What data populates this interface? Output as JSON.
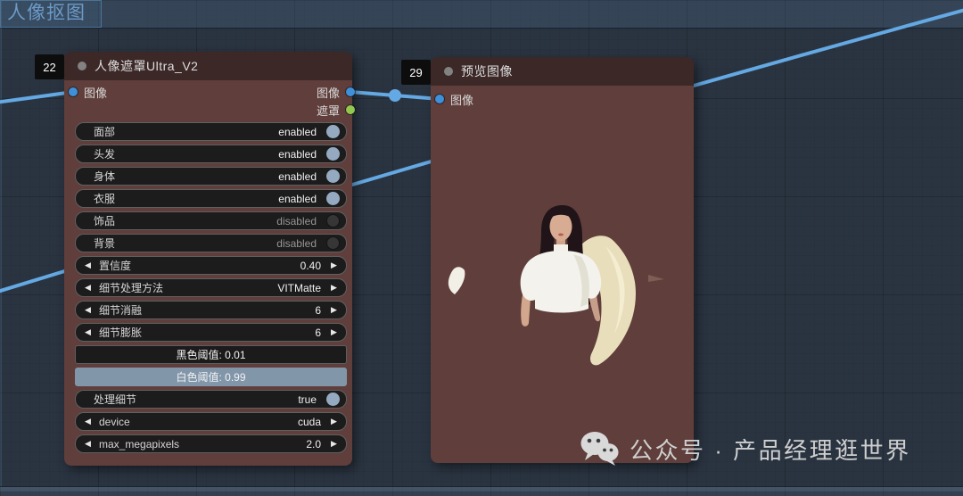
{
  "group": {
    "title": "人像抠图"
  },
  "colors": {
    "canvas_bg": "#2a3441",
    "node_body": "#5f3e3b",
    "node_header": "#3b2827",
    "widget_bg": "#1c1c1c",
    "widget_border": "#606060",
    "accent_fill": "#8296aa",
    "toggle_on": "#95aac1",
    "wire": "#64a9e3",
    "port_blue": "#3f90da",
    "port_green": "#93c84f",
    "badge_bg": "#0d0d0d",
    "group_title": "#6c9ac7",
    "watermark": "#cfcfcf"
  },
  "nodes": {
    "portrait_mask": {
      "id": "22",
      "title": "人像遮罩Ultra_V2",
      "inputs": [
        {
          "label": "图像",
          "color": "blue"
        }
      ],
      "outputs": [
        {
          "label": "图像",
          "color": "blue"
        },
        {
          "label": "遮罩",
          "color": "green"
        }
      ],
      "widgets": [
        {
          "name": "face",
          "type": "toggle",
          "label": "面部",
          "value": "enabled",
          "on": true
        },
        {
          "name": "hair",
          "type": "toggle",
          "label": "头发",
          "value": "enabled",
          "on": true
        },
        {
          "name": "body",
          "type": "toggle",
          "label": "身体",
          "value": "enabled",
          "on": true
        },
        {
          "name": "clothes",
          "type": "toggle",
          "label": "衣服",
          "value": "enabled",
          "on": true
        },
        {
          "name": "accessories",
          "type": "toggle",
          "label": "饰品",
          "value": "disabled",
          "on": false
        },
        {
          "name": "background",
          "type": "toggle",
          "label": "背景",
          "value": "disabled",
          "on": false
        },
        {
          "name": "confidence",
          "type": "combo",
          "label": "置信度",
          "value": "0.40"
        },
        {
          "name": "detail-method",
          "type": "combo",
          "label": "细节处理方法",
          "value": "VITMatte"
        },
        {
          "name": "detail-erode",
          "type": "combo",
          "label": "细节消融",
          "value": "6"
        },
        {
          "name": "detail-dilate",
          "type": "combo",
          "label": "细节膨胀",
          "value": "6"
        },
        {
          "name": "black-point",
          "type": "bar",
          "label": "黑色阈值",
          "value": "0.01",
          "filled": false
        },
        {
          "name": "white-point",
          "type": "bar",
          "label": "白色阈值",
          "value": "0.99",
          "filled": true
        },
        {
          "name": "process-detail",
          "type": "toggle",
          "label": "处理细节",
          "value": "true",
          "on": true
        },
        {
          "name": "device",
          "type": "combo",
          "label": "device",
          "value": "cuda"
        },
        {
          "name": "max-megapixels",
          "type": "combo",
          "label": "max_megapixels",
          "value": "2.0"
        }
      ]
    },
    "preview": {
      "id": "29",
      "title": "预览图像",
      "inputs": [
        {
          "label": "图像",
          "color": "blue"
        }
      ]
    }
  },
  "watermark": {
    "icon": "wechat-icon",
    "text": "公众号 · 产品经理逛世界"
  }
}
